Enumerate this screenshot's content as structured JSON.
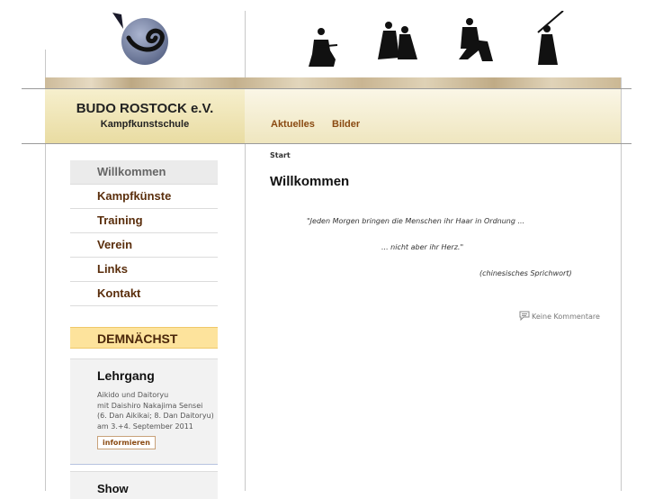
{
  "brand": {
    "name": "BUDO ROSTOCK e.V.",
    "subtitle": "Kampfkunstschule"
  },
  "topnav": {
    "items": [
      "Aktuelles",
      "Bilder"
    ]
  },
  "sidebar": {
    "items": [
      {
        "label": "Willkommen",
        "active": true
      },
      {
        "label": "Kampfkünste"
      },
      {
        "label": "Training"
      },
      {
        "label": "Verein"
      },
      {
        "label": "Links"
      },
      {
        "label": "Kontakt"
      }
    ]
  },
  "upcoming": {
    "heading": "DEMNÄCHST",
    "events": [
      {
        "title": "Lehrgang",
        "description": "Aikido und Daitoryu\nmit Daishiro Nakajima Sensei\n(6. Dan Aikikai; 8. Dan Daitoryu)\nam 3.+4. September 2011",
        "button": "informieren"
      },
      {
        "title": "Show"
      }
    ]
  },
  "main": {
    "breadcrumb": "Start",
    "title": "Willkommen",
    "quote_line1": "\"Jeden Morgen bringen die Menschen ihr Haar in Ordnung ...",
    "quote_line2": "... nicht aber ihr Herz.\"",
    "quote_source": "(chinesisches Sprichwort)",
    "comments": "Keine Kommentare"
  },
  "icons": [
    "logo-icon",
    "kneeling-swordsman-icon",
    "aikido-pair-icon",
    "throw-pair-icon",
    "kendo-icon",
    "comment-icon"
  ],
  "colors": {
    "accent": "#8a4a12",
    "highlight": "#fde39c",
    "brand_bg": "#efe3b0"
  }
}
